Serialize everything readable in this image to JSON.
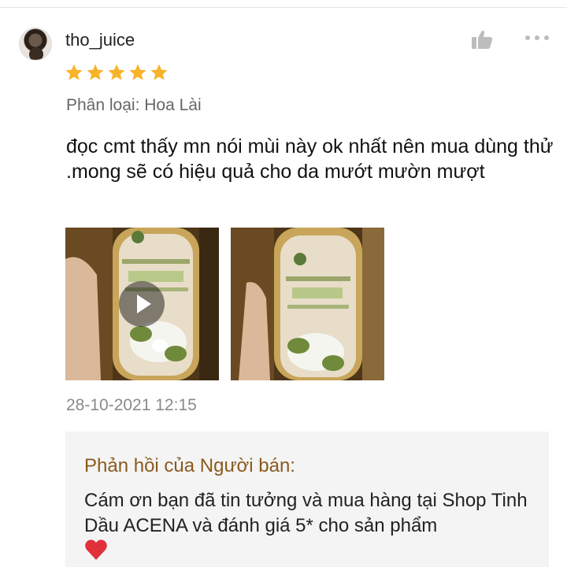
{
  "review": {
    "username": "tho_juice",
    "rating": 5,
    "variation_label": "Phân loại: Hoa Lài",
    "text": "đọc cmt thấy mn nói mùi này ok nhất nên mua dùng thử .mong sẽ có hiệu quả cho da mướt mườn mượt",
    "timestamp": "28-10-2021 12:15",
    "media": [
      {
        "type": "video",
        "icon": "play-icon"
      },
      {
        "type": "image"
      }
    ]
  },
  "seller_reply": {
    "title": "Phản hồi của Người bán:",
    "text": "Cám ơn bạn đã tin tưởng và mua hàng tại Shop Tinh Dầu ACENA và đánh giá 5* cho sản phẩm",
    "emoji": "heart-icon"
  },
  "icons": {
    "like": "thumbs-up-icon",
    "more": "more-options-icon",
    "star": "star-icon"
  },
  "colors": {
    "star": "#f7b329",
    "reply_title": "#8a5a1e",
    "reply_bg": "#f4f4f4",
    "heart": "#e0303a",
    "muted_text": "#8a8a8a"
  }
}
